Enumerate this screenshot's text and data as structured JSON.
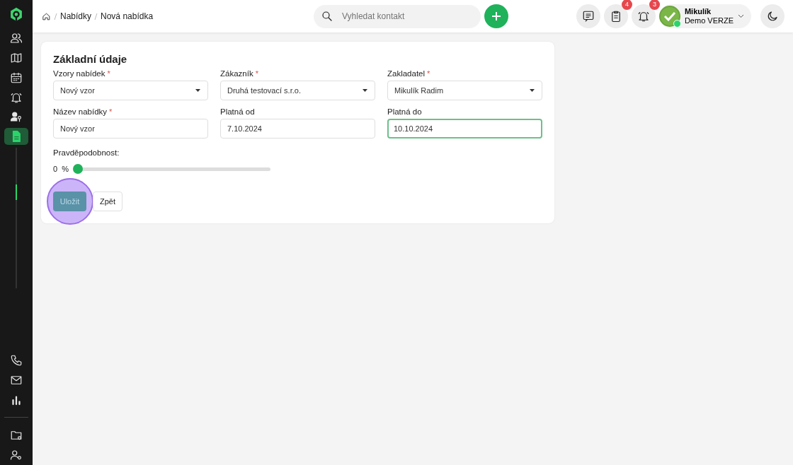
{
  "sidebar": {
    "items": [
      {
        "selected": false
      },
      {
        "selected": false
      },
      {
        "selected": false
      },
      {
        "selected": false
      },
      {
        "selected": false
      },
      {
        "selected": true
      }
    ],
    "bottom_items": [
      {
        "selected": false
      },
      {
        "selected": false
      },
      {
        "selected": false
      }
    ],
    "settings_items": [
      {
        "selected": false
      },
      {
        "selected": false
      }
    ]
  },
  "breadcrumb": [
    "Nabídky",
    "Nová nabídka"
  ],
  "search": {
    "placeholder": "Vyhledat kontakt"
  },
  "actions": [
    {
      "kind": "messages"
    },
    {
      "kind": "tasks",
      "badge": "4"
    },
    {
      "kind": "reminders",
      "badge": "3"
    }
  ],
  "user": {
    "name": "Mikulík",
    "subtitle": "Demo VERZE",
    "online": true
  },
  "form": {
    "title": "Základní údaje",
    "required_mark": "*",
    "fields": [
      {
        "kind": "select",
        "label": "Vzory nabídek",
        "required": true,
        "value": "Nový vzor",
        "focused": false
      },
      {
        "kind": "select",
        "label": "Zákazník",
        "required": true,
        "value": "Druhá testovací s.r.o.",
        "focused": false
      },
      {
        "kind": "select",
        "label": "Zakladatel",
        "required": true,
        "value": "Mikulík Radim",
        "focused": false
      },
      {
        "kind": "text",
        "label": "Název nabídky",
        "required": true,
        "value": "Nový vzor",
        "focused": false
      },
      {
        "kind": "text",
        "label": "Platná od",
        "required": false,
        "value": "7.10.2024",
        "focused": false
      },
      {
        "kind": "text",
        "label": "Platná do",
        "required": false,
        "value": "10.10.2024",
        "focused": true
      }
    ],
    "slider": {
      "label": "Pravděpodobnost:",
      "value": "0",
      "unit": "%",
      "level": 0
    },
    "buttons": [
      {
        "kind": "primary",
        "label": "Uložit",
        "highlighted": true
      },
      {
        "kind": "secondary",
        "label": "Zpět",
        "highlighted": false
      }
    ]
  }
}
